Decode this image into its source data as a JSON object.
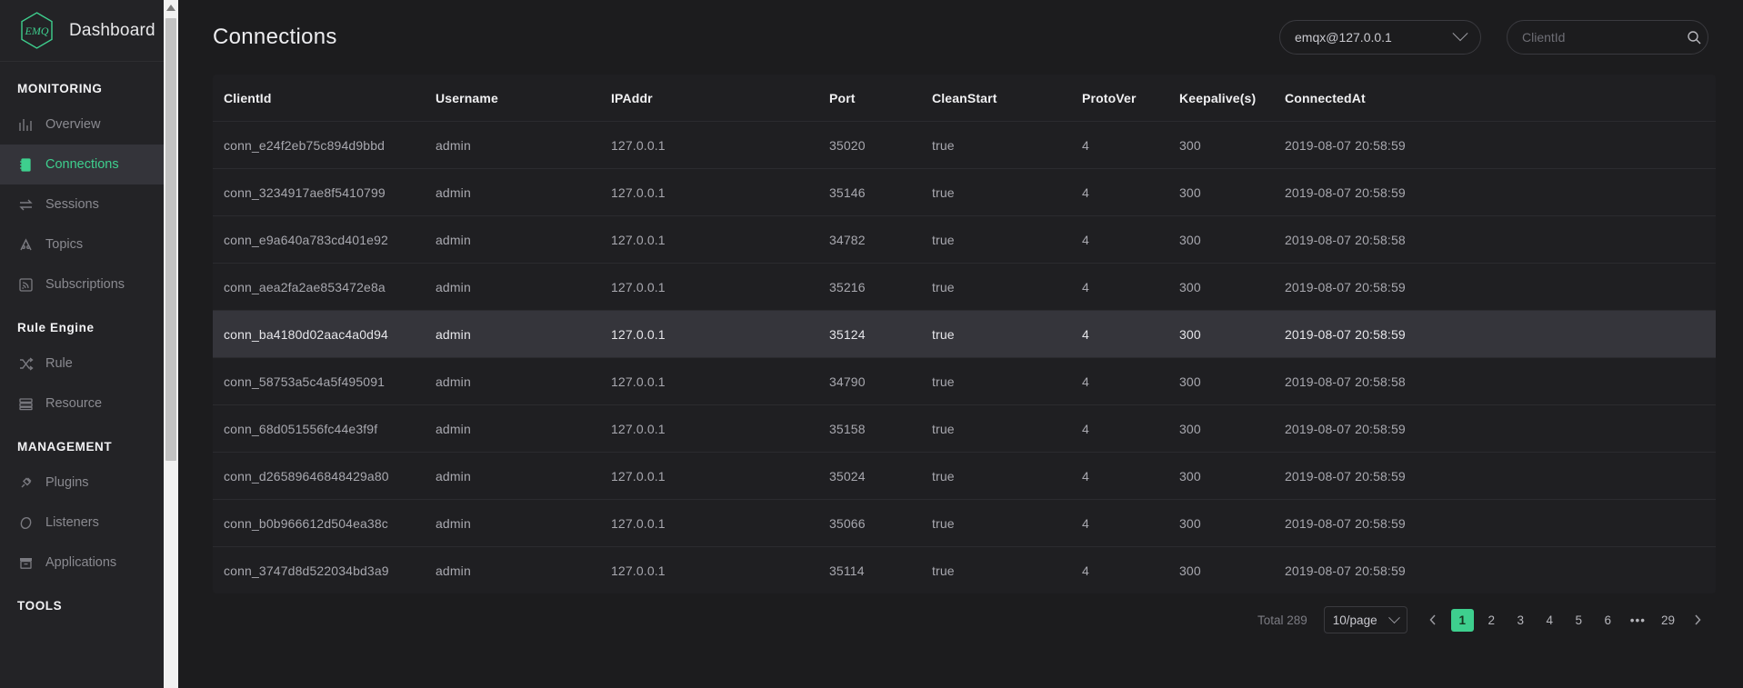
{
  "brand": {
    "logo_text": "EMQ",
    "title": "Dashboard"
  },
  "sidebar": {
    "sections": [
      {
        "label": "MONITORING",
        "items": [
          {
            "label": "Overview",
            "icon": "bar-chart-icon",
            "active": false
          },
          {
            "label": "Connections",
            "icon": "connections-icon",
            "active": true
          },
          {
            "label": "Sessions",
            "icon": "exchange-icon",
            "active": false
          },
          {
            "label": "Topics",
            "icon": "topics-icon",
            "active": false
          },
          {
            "label": "Subscriptions",
            "icon": "rss-icon",
            "active": false
          }
        ]
      },
      {
        "label": "Rule Engine",
        "items": [
          {
            "label": "Rule",
            "icon": "shuffle-icon",
            "active": false
          },
          {
            "label": "Resource",
            "icon": "server-icon",
            "active": false
          }
        ]
      },
      {
        "label": "MANAGEMENT",
        "items": [
          {
            "label": "Plugins",
            "icon": "plug-icon",
            "active": false
          },
          {
            "label": "Listeners",
            "icon": "listen-icon",
            "active": false
          },
          {
            "label": "Applications",
            "icon": "archive-icon",
            "active": false
          }
        ]
      },
      {
        "label": "TOOLS",
        "items": []
      }
    ]
  },
  "header": {
    "title": "Connections",
    "node_select": {
      "value": "emqx@127.0.0.1",
      "icon": "chevron-down-icon"
    },
    "search": {
      "value": "",
      "placeholder": "ClientId",
      "icon": "search-icon"
    }
  },
  "table": {
    "columns": [
      "ClientId",
      "Username",
      "IPAddr",
      "Port",
      "CleanStart",
      "ProtoVer",
      "Keepalive(s)",
      "ConnectedAt"
    ],
    "rows": [
      {
        "client_id": "conn_e24f2eb75c894d9bbd",
        "username": "admin",
        "ipaddr": "127.0.0.1",
        "port": "35020",
        "clean_start": "true",
        "proto_ver": "4",
        "keepalive": "300",
        "connected_at": "2019-08-07 20:58:59",
        "highlighted": false
      },
      {
        "client_id": "conn_3234917ae8f5410799",
        "username": "admin",
        "ipaddr": "127.0.0.1",
        "port": "35146",
        "clean_start": "true",
        "proto_ver": "4",
        "keepalive": "300",
        "connected_at": "2019-08-07 20:58:59",
        "highlighted": false
      },
      {
        "client_id": "conn_e9a640a783cd401e92",
        "username": "admin",
        "ipaddr": "127.0.0.1",
        "port": "34782",
        "clean_start": "true",
        "proto_ver": "4",
        "keepalive": "300",
        "connected_at": "2019-08-07 20:58:58",
        "highlighted": false
      },
      {
        "client_id": "conn_aea2fa2ae853472e8a",
        "username": "admin",
        "ipaddr": "127.0.0.1",
        "port": "35216",
        "clean_start": "true",
        "proto_ver": "4",
        "keepalive": "300",
        "connected_at": "2019-08-07 20:58:59",
        "highlighted": false
      },
      {
        "client_id": "conn_ba4180d02aac4a0d94",
        "username": "admin",
        "ipaddr": "127.0.0.1",
        "port": "35124",
        "clean_start": "true",
        "proto_ver": "4",
        "keepalive": "300",
        "connected_at": "2019-08-07 20:58:59",
        "highlighted": true
      },
      {
        "client_id": "conn_58753a5c4a5f495091",
        "username": "admin",
        "ipaddr": "127.0.0.1",
        "port": "34790",
        "clean_start": "true",
        "proto_ver": "4",
        "keepalive": "300",
        "connected_at": "2019-08-07 20:58:58",
        "highlighted": false
      },
      {
        "client_id": "conn_68d051556fc44e3f9f",
        "username": "admin",
        "ipaddr": "127.0.0.1",
        "port": "35158",
        "clean_start": "true",
        "proto_ver": "4",
        "keepalive": "300",
        "connected_at": "2019-08-07 20:58:59",
        "highlighted": false
      },
      {
        "client_id": "conn_d26589646848429a80",
        "username": "admin",
        "ipaddr": "127.0.0.1",
        "port": "35024",
        "clean_start": "true",
        "proto_ver": "4",
        "keepalive": "300",
        "connected_at": "2019-08-07 20:58:59",
        "highlighted": false
      },
      {
        "client_id": "conn_b0b966612d504ea38c",
        "username": "admin",
        "ipaddr": "127.0.0.1",
        "port": "35066",
        "clean_start": "true",
        "proto_ver": "4",
        "keepalive": "300",
        "connected_at": "2019-08-07 20:58:59",
        "highlighted": false
      },
      {
        "client_id": "conn_3747d8d522034bd3a9",
        "username": "admin",
        "ipaddr": "127.0.0.1",
        "port": "35114",
        "clean_start": "true",
        "proto_ver": "4",
        "keepalive": "300",
        "connected_at": "2019-08-07 20:58:59",
        "highlighted": false
      }
    ]
  },
  "pagination": {
    "total_label": "Total 289",
    "page_size": "10/page",
    "prev_icon": "chevron-left-icon",
    "next_icon": "chevron-right-icon",
    "pages": [
      {
        "label": "1",
        "current": true,
        "kind": "page"
      },
      {
        "label": "2",
        "current": false,
        "kind": "page"
      },
      {
        "label": "3",
        "current": false,
        "kind": "page"
      },
      {
        "label": "4",
        "current": false,
        "kind": "page"
      },
      {
        "label": "5",
        "current": false,
        "kind": "page"
      },
      {
        "label": "6",
        "current": false,
        "kind": "page"
      },
      {
        "label": "•••",
        "current": false,
        "kind": "dots"
      },
      {
        "label": "29",
        "current": false,
        "kind": "page"
      }
    ]
  },
  "colors": {
    "accent": "#3ecf8e",
    "sidebar_bg": "#232326",
    "page_bg": "#1c1c1e",
    "card_bg": "#1f1f22",
    "row_highlight": "#35353b"
  }
}
